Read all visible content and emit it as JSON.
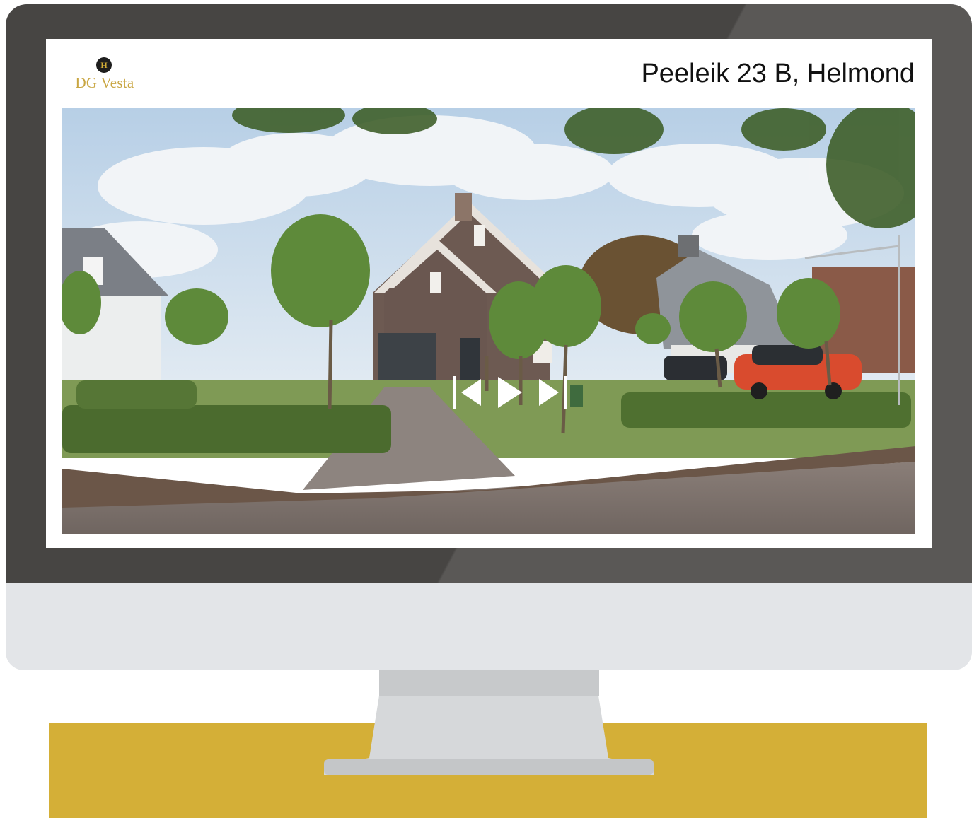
{
  "listing": {
    "brand": "DG Vesta",
    "address": "Peeleik 23 B, Helmond"
  },
  "media_controls": {
    "previous_icon": "skip-previous-icon",
    "play_icon": "play-icon",
    "next_icon": "skip-next-icon"
  },
  "colors": {
    "brand_gold": "#d4af37",
    "bezel": "#474543",
    "chin": "#e3e5e8"
  }
}
